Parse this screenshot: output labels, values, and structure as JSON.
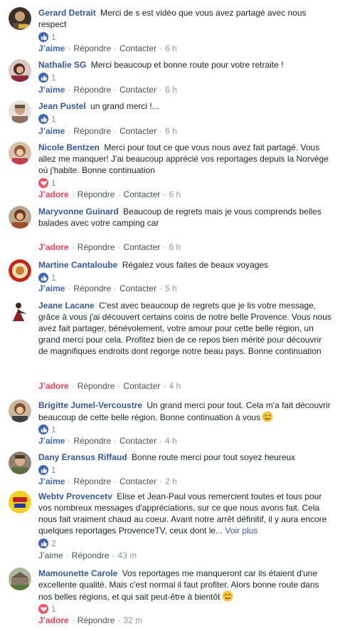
{
  "actions": {
    "reply": "Répondre",
    "contact": "Contacter",
    "more": "Voir plus"
  },
  "comments": [
    {
      "author": "Gerard Detrait",
      "text": "Merci de s est vidéo que vous avez partagé avec nous respect",
      "reaction": "like",
      "count": "1",
      "action": "J’aime",
      "time": "6 h",
      "has_reply_contact": true,
      "avatar_color": "#5a4a3a"
    },
    {
      "author": "Nathalie SG",
      "text": "Merci beaucoup et bonne route pour votre retraite !",
      "reaction": "like",
      "count": "1",
      "action": "J’aime",
      "time": "6 h",
      "has_reply_contact": true,
      "avatar_color": "#7a3a4a"
    },
    {
      "author": "Jean Pustel",
      "text": "un grand merci !...",
      "reaction": "like",
      "count": "1",
      "action": "J’aime",
      "time": "6 h",
      "has_reply_contact": true,
      "avatar_color": "#8a7060"
    },
    {
      "author": "Nicole Bentzen",
      "text": "Merci pour tout ce que vous nous avez fait partagé. Vous allez me manquer! J'ai beaucoup apprécié vos reportages depuis la Norvège où j'habite. Bonne continuation",
      "reaction": "love",
      "count": "1",
      "action": "J’adore",
      "time": "6 h",
      "has_reply_contact": true,
      "avatar_color": "#a06a4a"
    },
    {
      "author": "Maryvonne Guinard",
      "text": "Beaucoup de regrets mais je vous comprends belles balades avec votre camping car",
      "reaction": "",
      "count": "",
      "action": "J’adore",
      "time": "6 h",
      "has_reply_contact": true,
      "avatar_color": "#8a5a3a"
    },
    {
      "author": "Martine Cantaloube",
      "text": "Régalez vous faites de beaux voyages",
      "reaction": "like",
      "count": "1",
      "action": "J’aime",
      "time": "5 h",
      "has_reply_contact": true,
      "avatar_color": "#b03020"
    },
    {
      "author": "Jeane Lacane",
      "text": "C'est avec beaucoup de regrets que je lis votre message, grâce à vous j'ai découvert certains coins de notre belle Provence. Vous nous avez fait partager, bénévolement, votre amour pour cette belle région, un grand merci pour cela. Profitez bien de ce repos bien mérité pour découvrir de magnifiques endroits dont regorge notre beau pays. Bonne continuation",
      "reaction": "",
      "count": "",
      "action": "J’adore",
      "time": "4 h",
      "has_reply_contact": true,
      "avatar_color": "#d0c4b0"
    },
    {
      "author": "Brigitte Jumel-Vercoustre",
      "text": "Un grand merci pour tout. Cela m'a fait découvrir beaucoup de cette belle région. Bonne continuation à vous",
      "reaction": "like",
      "count": "1",
      "action": "J’aime",
      "time": "4 h",
      "has_reply_contact": true,
      "avatar_color": "#a08060",
      "emoji": "wink"
    },
    {
      "author": "Dany Eransus Riffaud",
      "text": "Bonne route merci pour tout soyez heureux",
      "reaction": "like",
      "count": "1",
      "action": "J’aime",
      "time": "2 h",
      "has_reply_contact": true,
      "avatar_color": "#706050"
    },
    {
      "author": "Webtv Provencetv",
      "text": "Elise et Jean-Paul vous remercient toutes et tous pour vos nombreux messages d'appréciations, sur ce que nous avons fait. Cela nous fait vraiment chaud au coeur. Avant notre arrêt définitif, il y aura encore quelques reportages ProvenceTV, ceux dont le...",
      "reaction": "like",
      "count": "2",
      "action": "J’aime",
      "time": "43 m",
      "has_reply_contact": false,
      "show_more": true,
      "avatar_color": "#f0d020"
    },
    {
      "author": "Mamounette Carole",
      "text": "Vos reportages me manqueront car ils étaient d'une excellente qualité. Mais c'est normal il faut profiter. Alors bonne route dans nos belles régions, et qui sait peut-être à bientôt",
      "reaction": "love",
      "count": "1",
      "action": "J’adore",
      "time": "32 m",
      "has_reply_contact": false,
      "avatar_color": "#7a8a6a",
      "emoji": "smile"
    }
  ]
}
